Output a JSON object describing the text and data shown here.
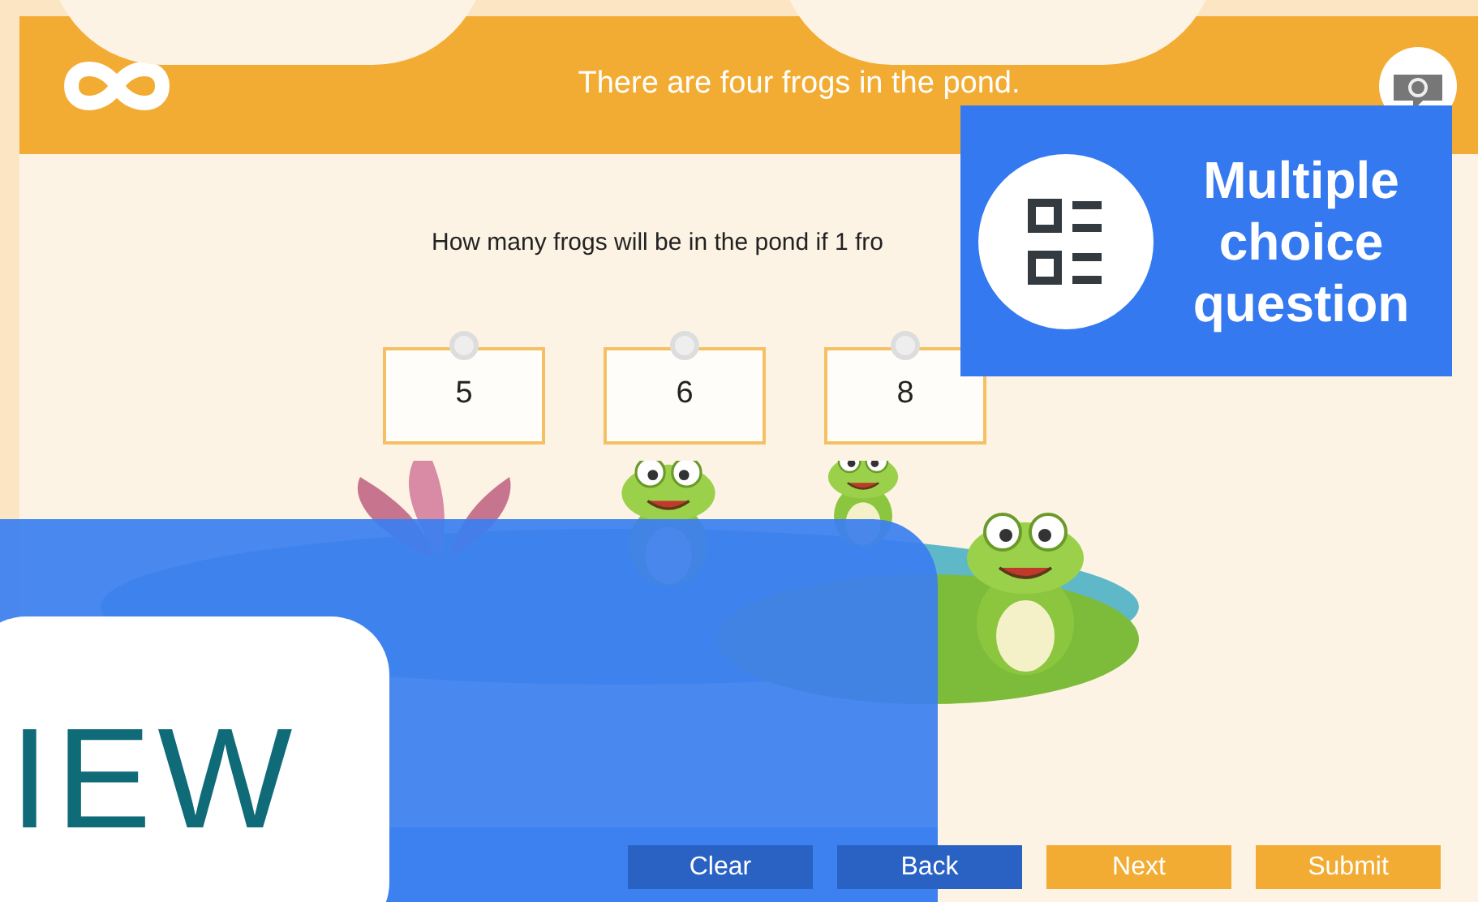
{
  "header": {
    "title": "There are four frogs in the pond."
  },
  "question": "How many frogs will be in the pond if 1 fro",
  "options": [
    {
      "label": "5",
      "selected": false
    },
    {
      "label": "6",
      "selected": false
    },
    {
      "label": "8",
      "selected": false
    }
  ],
  "buttons": [
    {
      "label": "Clear",
      "dimmed": true
    },
    {
      "label": "Back",
      "dimmed": true
    },
    {
      "label": "Next",
      "dimmed": false
    },
    {
      "label": "Submit",
      "dimmed": false
    }
  ],
  "badge": {
    "label": "Multiple choice question"
  },
  "overlay_card": {
    "text": "IEW"
  }
}
